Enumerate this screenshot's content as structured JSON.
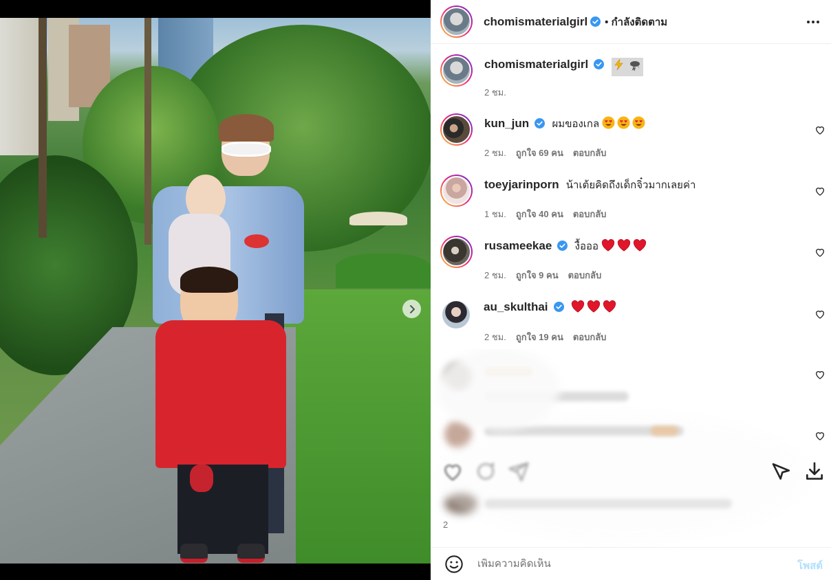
{
  "post_author": {
    "username": "chomismaterialgirl",
    "follow_status": "• กำลังติดตาม",
    "more_icon": "more-horizontal-icon"
  },
  "caption": {
    "username": "chomismaterialgirl",
    "time": "2 ชม."
  },
  "comments": [
    {
      "username": "kun_jun",
      "text": "ผมของเกล",
      "reaction": "heart-eyes-emoji",
      "reaction_count": 3,
      "time": "2 ชม.",
      "likes": "ถูกใจ 69 คน",
      "reply": "ตอบกลับ"
    },
    {
      "username": "toeyjarinporn",
      "text": "น้าเต้ยคิดถึงเด็กจิ๋วมากเลยค่า",
      "time": "1 ชม.",
      "likes": "ถูกใจ 40 คน",
      "reply": "ตอบกลับ"
    },
    {
      "username": "rusameekae",
      "text": "งื้อออ",
      "reaction": "red-heart-emoji",
      "reaction_count": 3,
      "time": "2 ชม.",
      "likes": "ถูกใจ 9 คน",
      "reply": "ตอบกลับ"
    },
    {
      "username": "au_skulthai",
      "text": "",
      "reaction": "red-heart-emoji",
      "reaction_count": 3,
      "time": "2 ชม.",
      "likes": "ถูกใจ 19 คน",
      "reply": "ตอบกลับ"
    }
  ],
  "blurred_time": "2",
  "composer": {
    "placeholder": "เพิ่มความคิดเห็น",
    "post_label": "โพสต์"
  },
  "colors": {
    "verified": "#3897f0",
    "post_button_disabled": "#b2dffc",
    "meta_text": "#737373"
  },
  "carousel": {
    "slides": 6,
    "active_index": 0
  }
}
